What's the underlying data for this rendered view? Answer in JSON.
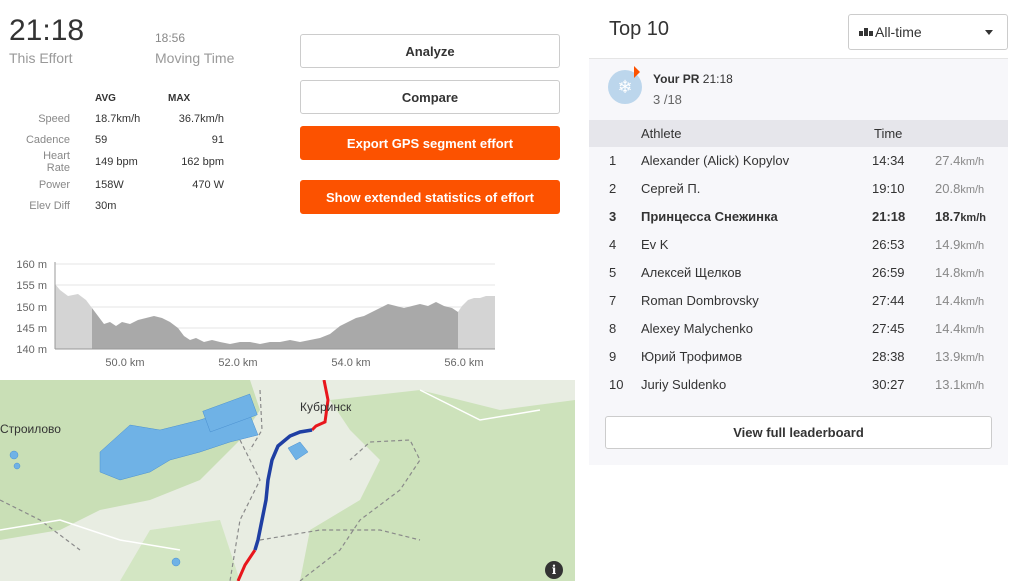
{
  "effort": {
    "time": "21:18",
    "time_label": "This Effort",
    "moving_time": "18:56",
    "moving_label": "Moving Time"
  },
  "stats": {
    "avg_header": "AVG",
    "max_header": "MAX",
    "rows": [
      {
        "label": "Speed",
        "avg": "18.7km/h",
        "max": "36.7km/h"
      },
      {
        "label": "Cadence",
        "avg": "59",
        "max": "91"
      },
      {
        "label": "Heart Rate",
        "avg": "149 bpm",
        "max": "162 bpm"
      },
      {
        "label": "Power",
        "avg": "158W",
        "max": "470 W"
      },
      {
        "label": "Elev Diff",
        "avg": "30m",
        "max": ""
      }
    ]
  },
  "buttons": {
    "analyze": "Analyze",
    "compare": "Compare",
    "export": "Export GPS segment effort",
    "extended": "Show extended statistics of effort"
  },
  "elevation": {
    "y_ticks": [
      "160 m",
      "155 m",
      "150 m",
      "145 m",
      "140 m"
    ],
    "x_ticks": [
      "50.0 km",
      "52.0 km",
      "54.0 km",
      "56.0 km"
    ]
  },
  "map": {
    "labels": [
      "Кубринск",
      "Строилово"
    ],
    "info_icon": "i"
  },
  "leaderboard": {
    "title": "Top 10",
    "filter": "All-time",
    "pr_label": "Your PR",
    "pr_time": "21:18",
    "pr_rank": "3 /18",
    "col_athlete": "Athlete",
    "col_time": "Time",
    "rows": [
      {
        "rank": "1",
        "name": "Alexander (Alick) Kopylov",
        "time": "14:34",
        "speed": "27.4",
        "unit": "km/h"
      },
      {
        "rank": "2",
        "name": "Сергей П.",
        "time": "19:10",
        "speed": "20.8",
        "unit": "km/h"
      },
      {
        "rank": "3",
        "name": "Принцесса Снежинка",
        "time": "21:18",
        "speed": "18.7",
        "unit": "km/h"
      },
      {
        "rank": "4",
        "name": "Ev K",
        "time": "26:53",
        "speed": "14.9",
        "unit": "km/h"
      },
      {
        "rank": "5",
        "name": "Алексей Щелков",
        "time": "26:59",
        "speed": "14.8",
        "unit": "km/h"
      },
      {
        "rank": "7",
        "name": "Roman Dombrovsky",
        "time": "27:44",
        "speed": "14.4",
        "unit": "km/h"
      },
      {
        "rank": "8",
        "name": "Alexey Malychenko",
        "time": "27:45",
        "speed": "14.4",
        "unit": "km/h"
      },
      {
        "rank": "9",
        "name": "Юрий Трофимов",
        "time": "28:38",
        "speed": "13.9",
        "unit": "km/h"
      },
      {
        "rank": "10",
        "name": "Juriy Suldenko",
        "time": "30:27",
        "speed": "13.1",
        "unit": "km/h"
      }
    ],
    "view_full": "View full leaderboard"
  },
  "colors": {
    "accent": "#fc5200",
    "route_red": "#e8161c",
    "route_blue": "#1f3fa3",
    "water": "#5aa8e0"
  }
}
